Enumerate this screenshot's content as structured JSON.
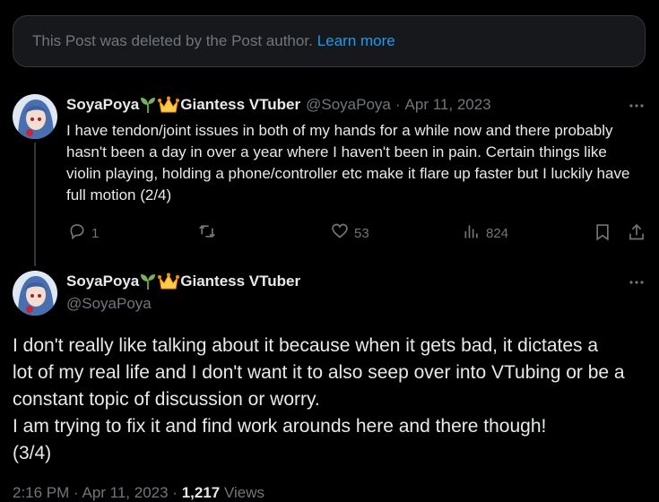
{
  "deleted_notice": {
    "text": "This Post was deleted by the Post author.",
    "link": "Learn more"
  },
  "post1": {
    "display_name": "SoyaPoya",
    "name_suffix": "Giantess VTuber",
    "handle": "@SoyaPoya",
    "separator": "·",
    "date": "Apr 11, 2023",
    "text": "I have tendon/joint issues in both of my hands for a while now and there probably hasn't been a day in over a year where I haven't been in pain. Certain things like violin playing, holding a phone/controller etc make it flare up faster but I luckily have full motion (2/4)",
    "replies": "1",
    "reposts": "",
    "likes": "53",
    "views": "824",
    "icons": [
      "reply-icon",
      "repost-icon",
      "like-icon",
      "views-icon",
      "bookmark-icon",
      "share-icon",
      "more-icon",
      "seedling-icon",
      "crown-icon"
    ]
  },
  "post2": {
    "display_name": "SoyaPoya",
    "name_suffix": "Giantess VTuber",
    "handle": "@SoyaPoya",
    "lines": [
      "I don't really like talking about it because when it gets bad, it dictates a",
      "lot of my real life and I don't want it to also seep over into VTubing or be a",
      "constant topic of discussion or worry.",
      "I am trying to fix it and find work arounds here and there though!",
      "(3/4)"
    ],
    "meta_time": "2:16 PM · Apr 11, 2023 ·",
    "meta_views_count": "1,217",
    "meta_views_label": "Views"
  },
  "colors": {
    "background": "#000000",
    "text": "#e7e9ea",
    "muted": "#71767b",
    "link": "#1d9bf0",
    "border": "#333639"
  }
}
